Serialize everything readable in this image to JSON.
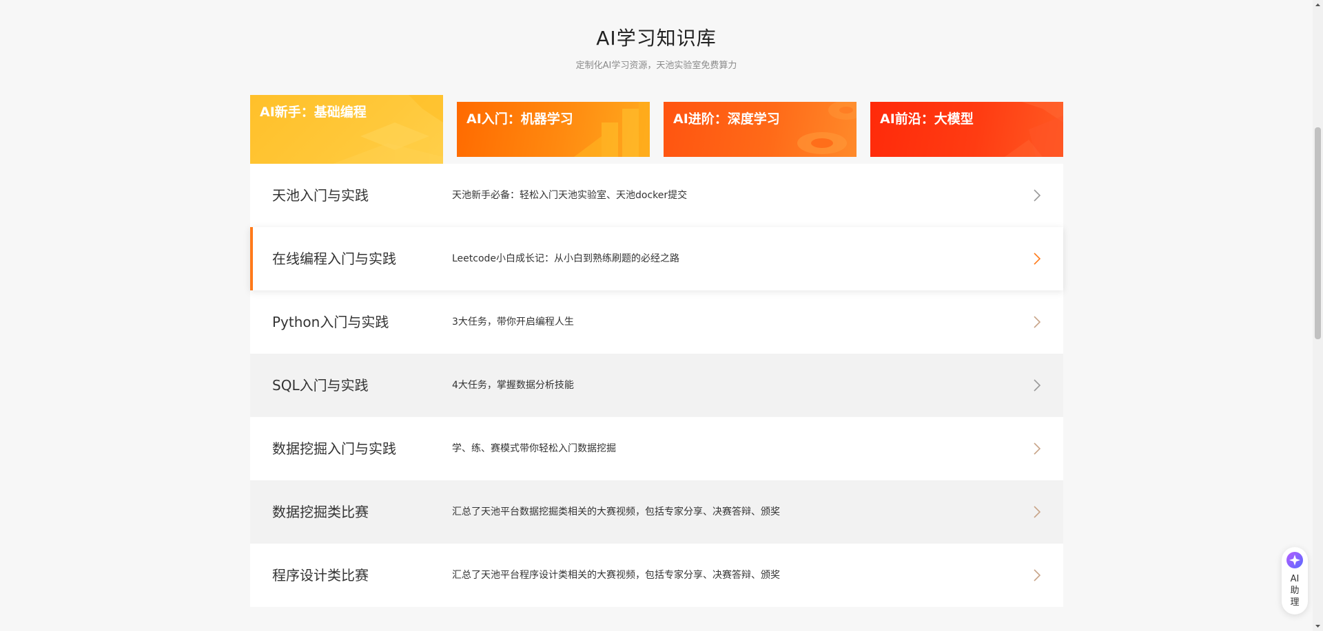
{
  "header": {
    "title": "AI学习知识库",
    "subtitle": "定制化AI学习资源，天池实验室免费算力"
  },
  "tabs": [
    {
      "label": "AI新手：基础编程",
      "active": true,
      "color_from": "#ffc629",
      "color_to": "#ffb020"
    },
    {
      "label": "AI入门：机器学习",
      "active": false,
      "color_from": "#ff6a00",
      "color_to": "#ffa21a"
    },
    {
      "label": "AI进阶：深度学习",
      "active": false,
      "color_from": "#ff5a14",
      "color_to": "#ff8a1f"
    },
    {
      "label": "AI前沿：大模型",
      "active": false,
      "color_from": "#ff2a0a",
      "color_to": "#ff5a1f"
    }
  ],
  "courses": [
    {
      "title": "天池入门与实践",
      "desc": "天池新手必备：轻松入门天池实验室、天池docker提交"
    },
    {
      "title": "在线编程入门与实践",
      "desc": "Leetcode小白成长记：从小白到熟练刷题的必经之路"
    },
    {
      "title": "Python入门与实践",
      "desc": "3大任务，带你开启编程人生"
    },
    {
      "title": "SQL入门与实践",
      "desc": "4大任务，掌握数据分析技能"
    },
    {
      "title": "数据挖掘入门与实践",
      "desc": "学、练、赛模式带你轻松入门数据挖掘"
    },
    {
      "title": "数据挖掘类比赛",
      "desc": "汇总了天池平台数据挖掘类相关的大赛视频，包括专家分享、决赛答辩、颁奖"
    },
    {
      "title": "程序设计类比赛",
      "desc": "汇总了天池平台程序设计类相关的大赛视频，包括专家分享、决赛答辩、颁奖"
    }
  ],
  "assistant": {
    "label": "AI助理",
    "icon": "sparkle-icon"
  },
  "colors": {
    "accent": "#ff7a1a",
    "arrow": "#c8a488"
  }
}
